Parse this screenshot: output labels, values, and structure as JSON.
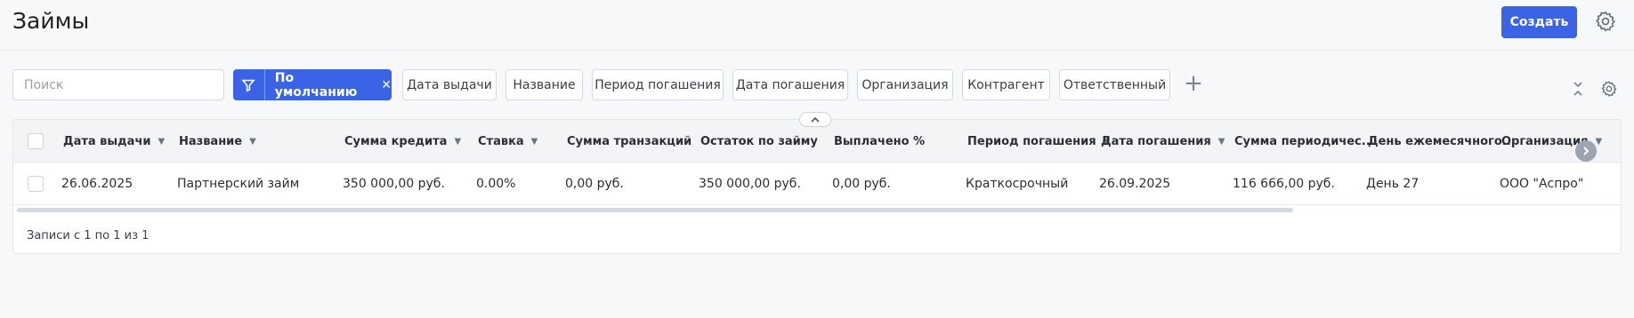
{
  "page": {
    "title": "Займы"
  },
  "toolbar": {
    "create_label": "Создать",
    "settings_icon": "gear-icon"
  },
  "search": {
    "placeholder": "Поиск",
    "value": ""
  },
  "filters": {
    "active_preset": "По умолчанию",
    "chips": [
      "Дата выдачи",
      "Название",
      "Период погашения",
      "Дата погашения",
      "Организация",
      "Контрагент",
      "Ответственный"
    ],
    "add_icon": "plus-icon"
  },
  "table": {
    "columns": [
      "Дата выдачи",
      "Название",
      "Сумма кредита",
      "Ставка",
      "Сумма транзакций",
      "Остаток по займу",
      "Выплачено %",
      "Период погашения",
      "Дата погашения",
      "Сумма периодичес...",
      "День ежемесячного...",
      "Организация"
    ],
    "rows": [
      [
        "26.06.2025",
        "Партнерский займ",
        "350 000,00 руб.",
        "0.00%",
        "0,00 руб.",
        "350 000,00 руб.",
        "0,00 руб.",
        "Краткосрочный",
        "26.09.2025",
        "116 666,00 руб.",
        "День 27",
        "ООО \"Аспро\""
      ]
    ],
    "footer": "Записи с 1 по 1 из 1"
  },
  "colors": {
    "accent": "#3a63e6",
    "background": "#f7f8fa",
    "header_row": "#f3f4f6"
  }
}
